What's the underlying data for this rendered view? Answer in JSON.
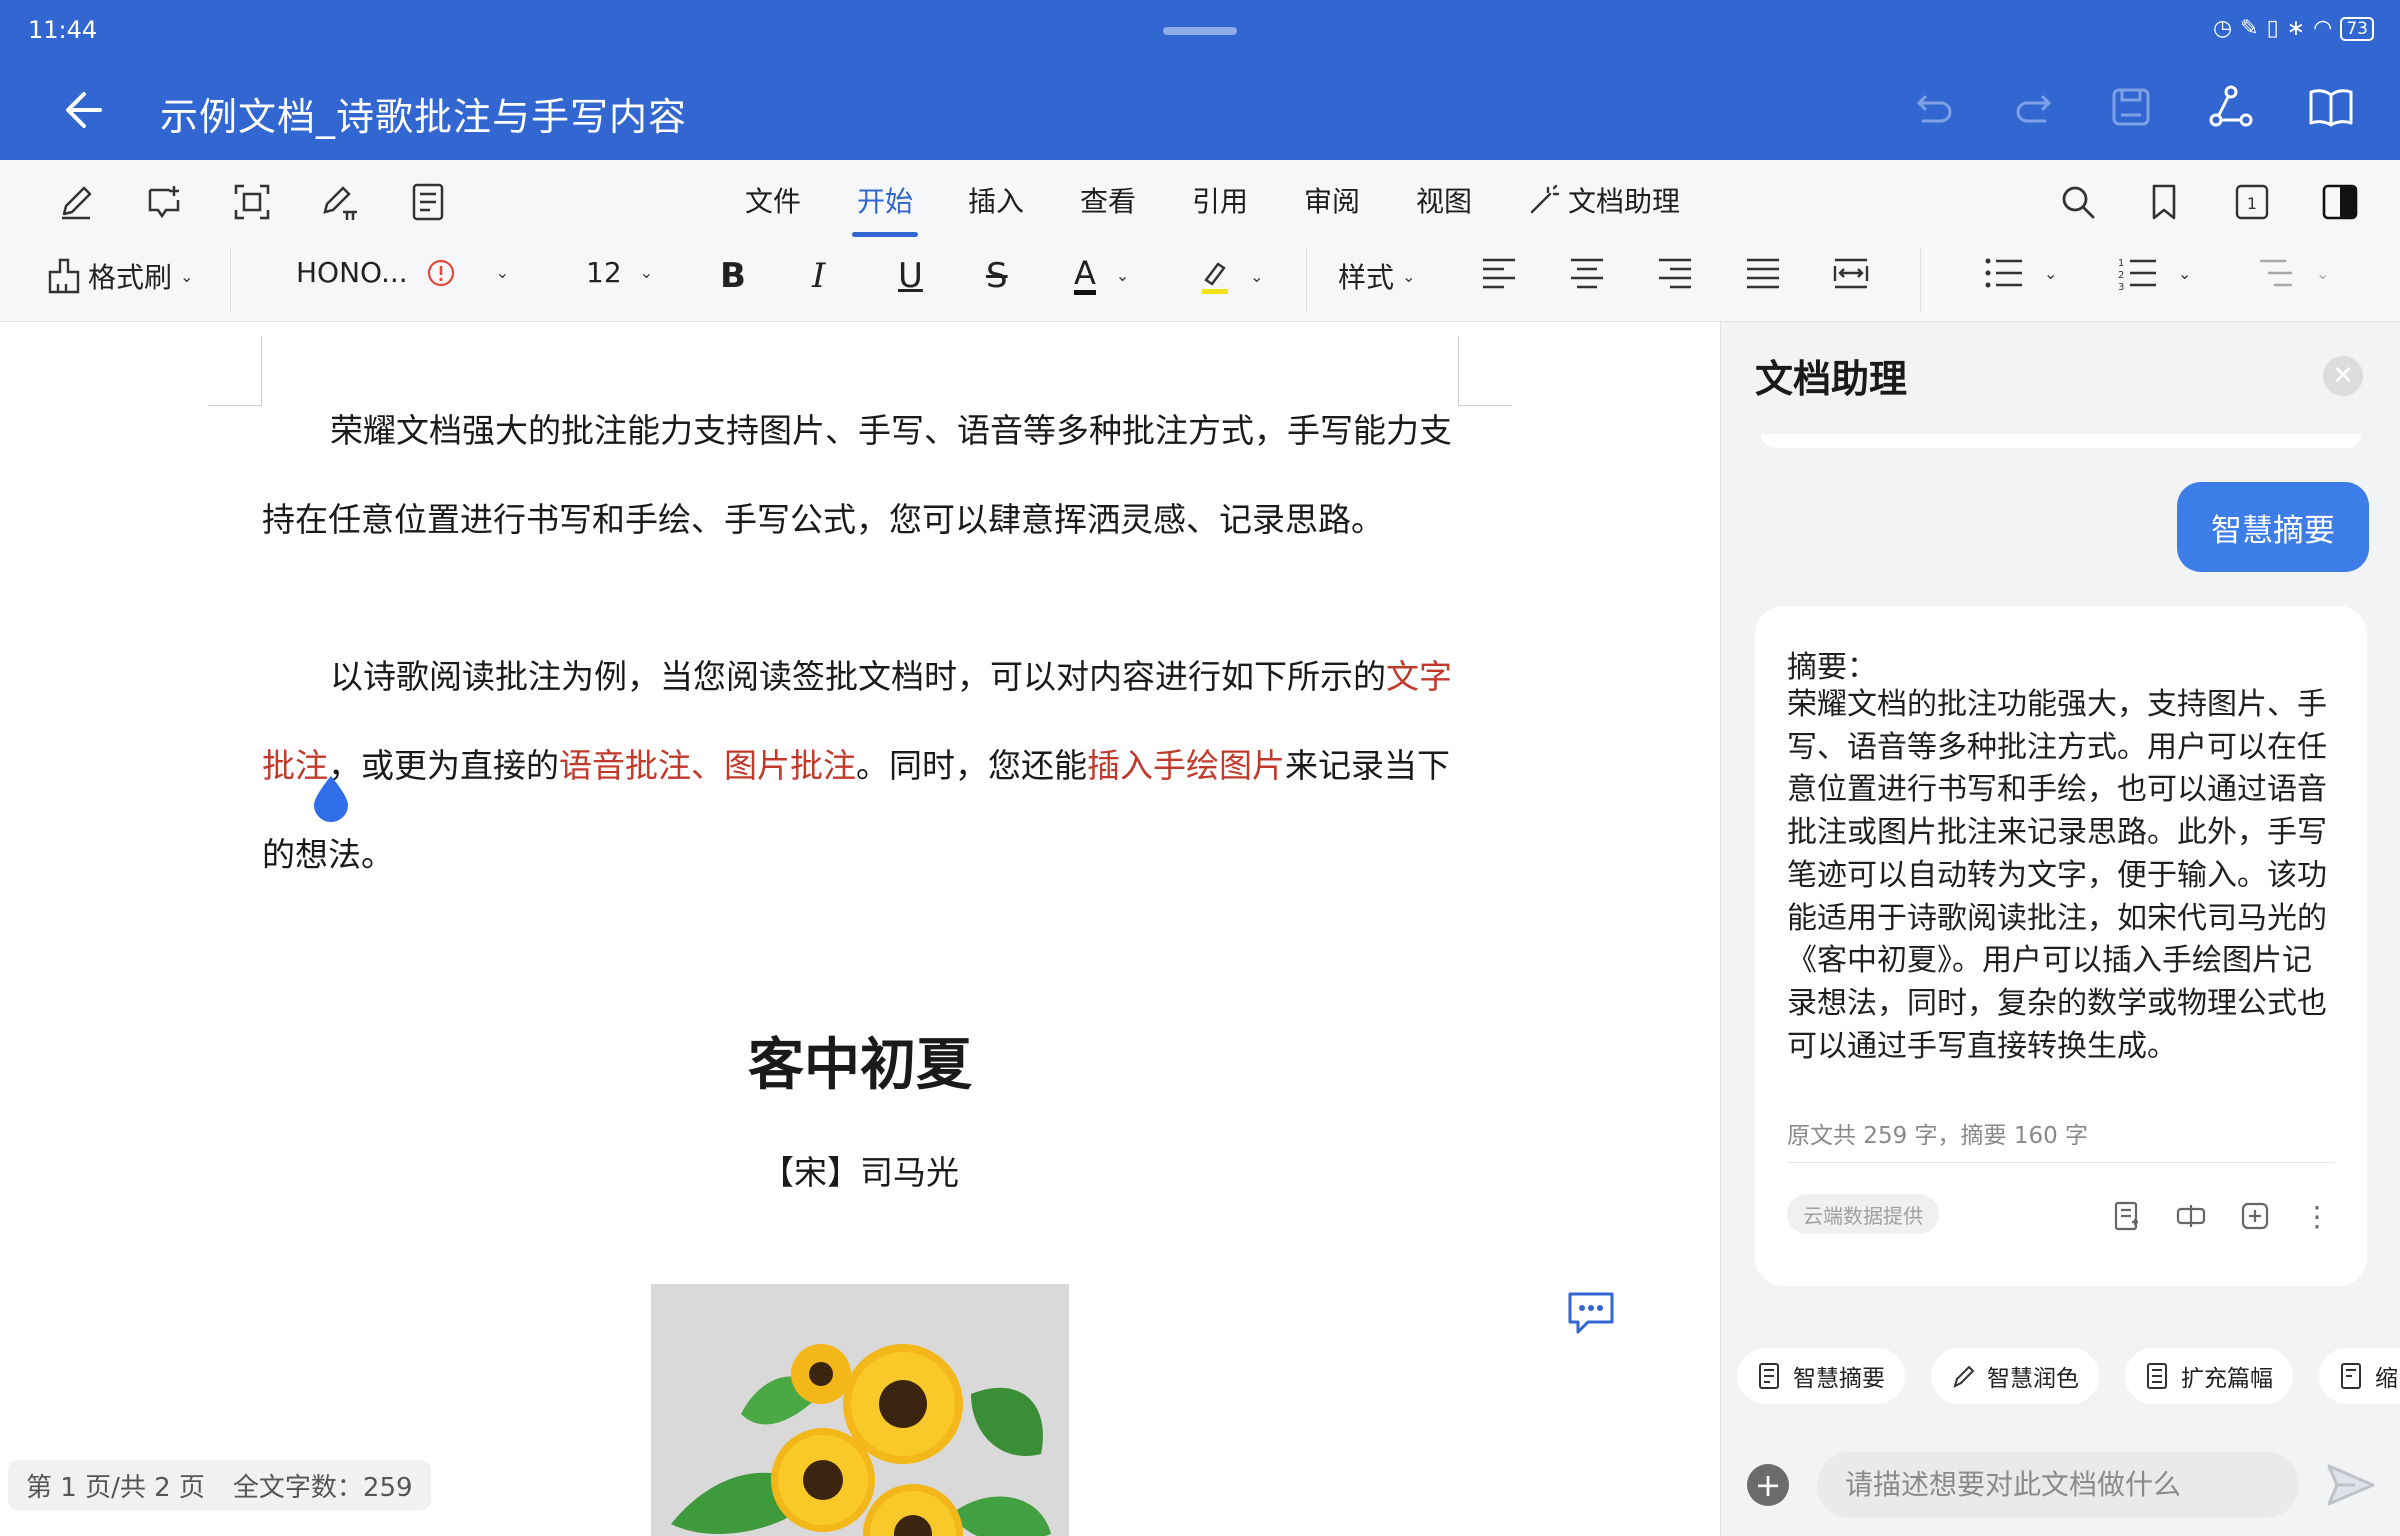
{
  "status_bar": {
    "time": "11:44",
    "battery": "73"
  },
  "header": {
    "title": "示例文档_诗歌批注与手写内容"
  },
  "menu_tabs": [
    "文件",
    "开始",
    "插入",
    "查看",
    "引用",
    "审阅",
    "视图",
    "文档助理"
  ],
  "active_tab": "开始",
  "format_toolbar": {
    "format_painter": "格式刷",
    "font_name": "HONO...",
    "font_size": "12",
    "bold": "B",
    "italic": "I",
    "underline": "U",
    "strike": "S",
    "font_color": "A",
    "style": "样式"
  },
  "document": {
    "para1": "荣耀文档强大的批注能力支持图片、手写、语音等多种批注方式，手写能力支持在任意位置进行书写和手绘、手写公式，您可以肆意挥洒灵感、记录思路。",
    "para2": {
      "seg1": "以诗歌阅读批注为例，当您阅读签批文档时，可以对内容进行如下所示的",
      "seg2": "文字批注",
      "seg3": "，或更为直接的",
      "seg4": "语音批注、图片批注",
      "seg5": "。同时，您还能",
      "seg6": "插入手绘图片",
      "seg7": "来记录当下的想法。"
    },
    "poem_title": "客中初夏",
    "poem_author": "【宋】司马光"
  },
  "page_status": {
    "pages": "第 1 页/共 2 页",
    "word_count": "全文字数：259"
  },
  "assistant": {
    "title": "文档助理",
    "summary_button": "智慧摘要",
    "card": {
      "heading": "摘要：",
      "body": "荣耀文档的批注功能强大，支持图片、手写、语音等多种批注方式。用户可以在任意位置进行书写和手绘，也可以通过语音批注或图片批注来记录思路。此外，手写笔迹可以自动转为文字，便于输入。该功能适用于诗歌阅读批注，如宋代司马光的《客中初夏》。用户可以插入手绘图片记录想法，同时，复杂的数学或物理公式也可以通过手写直接转换生成。",
      "count": "原文共 259 字，摘要 160 字",
      "source_tag": "云端数据提供"
    },
    "chips": [
      "智慧摘要",
      "智慧润色",
      "扩充篇幅",
      "缩"
    ],
    "input_placeholder": "请描述想要对此文档做什么"
  },
  "colors": {
    "brand": "#3266d1",
    "accent": "#3d7de8",
    "annotation_red": "#c0392b"
  }
}
